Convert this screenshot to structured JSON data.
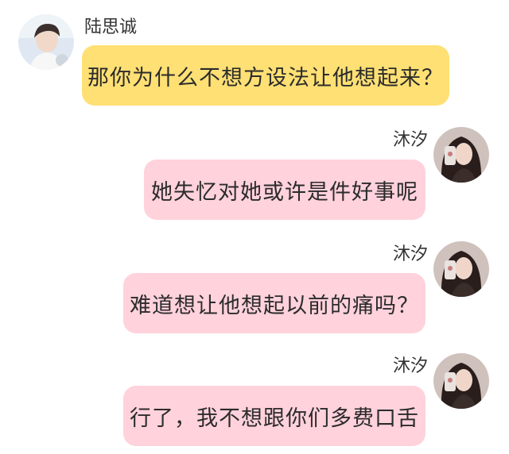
{
  "chat": {
    "messages": [
      {
        "sender": "陆思诚",
        "text": "那你为什么不想方设法让他想起来？",
        "side": "left",
        "bubble_color": "#ffe074"
      },
      {
        "sender": "沐汐",
        "text": "她失忆对她或许是件好事呢",
        "side": "right",
        "bubble_color": "#ffd2dc"
      },
      {
        "sender": "沐汐",
        "text": "难道想让他想起以前的痛吗？",
        "side": "right",
        "bubble_color": "#ffd2dc"
      },
      {
        "sender": "沐汐",
        "text": "行了，我不想跟你们多费口舌",
        "side": "right",
        "bubble_color": "#ffd2dc"
      }
    ]
  }
}
